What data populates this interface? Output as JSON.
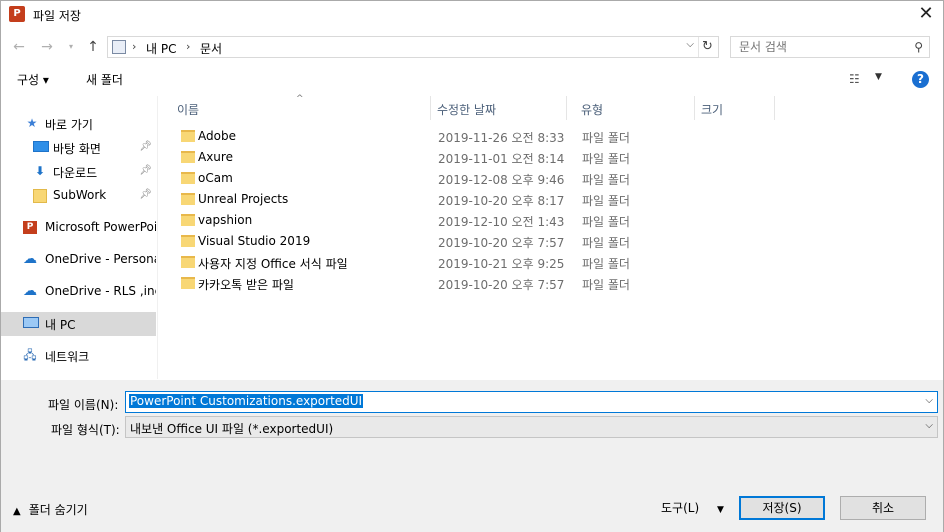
{
  "window": {
    "title": "파일 저장",
    "app_icon_glyph": "P"
  },
  "address": {
    "crumbs": [
      "내 PC",
      "문서"
    ],
    "search_placeholder": "문서 검색"
  },
  "toolbar": {
    "organize": "구성 ▾",
    "new_folder": "새 폴더",
    "help": "?"
  },
  "nav": {
    "items": [
      {
        "label": "바로 가기",
        "icon": "star-icon"
      },
      {
        "label": "바탕 화면",
        "icon": "desktop-icon",
        "pinned": true
      },
      {
        "label": "다운로드",
        "icon": "download-icon",
        "pinned": true
      },
      {
        "label": "SubWork",
        "icon": "folder-icon",
        "pinned": true
      },
      {
        "label": "Microsoft PowerPoin",
        "icon": "powerpoint-icon"
      },
      {
        "label": "OneDrive - Personal",
        "icon": "onedrive-icon"
      },
      {
        "label": "OneDrive - RLS ,inc",
        "icon": "onedrive-icon"
      },
      {
        "label": "내 PC",
        "icon": "pc-icon"
      },
      {
        "label": "네트워크",
        "icon": "network-icon"
      }
    ]
  },
  "columns": {
    "name": "이름",
    "date": "수정한 날짜",
    "type": "유형",
    "size": "크기"
  },
  "files": [
    {
      "name": "Adobe",
      "date": "2019-11-26 오전 8:33",
      "type": "파일 폴더"
    },
    {
      "name": "Axure",
      "date": "2019-11-01 오전 8:14",
      "type": "파일 폴더"
    },
    {
      "name": "oCam",
      "date": "2019-12-08 오후 9:46",
      "type": "파일 폴더"
    },
    {
      "name": "Unreal Projects",
      "date": "2019-10-20 오후 8:17",
      "type": "파일 폴더"
    },
    {
      "name": "vapshion",
      "date": "2019-12-10 오전 1:43",
      "type": "파일 폴더"
    },
    {
      "name": "Visual Studio 2019",
      "date": "2019-10-20 오후 7:57",
      "type": "파일 폴더"
    },
    {
      "name": "사용자 지정 Office 서식 파일",
      "date": "2019-10-21 오후 9:25",
      "type": "파일 폴더"
    },
    {
      "name": "카카오톡 받은 파일",
      "date": "2019-10-20 오후 7:57",
      "type": "파일 폴더"
    }
  ],
  "form": {
    "filename_label": "파일 이름(N):",
    "filename_value": "PowerPoint Customizations.exportedUI",
    "filetype_label": "파일 형식(T):",
    "filetype_value": "내보낸 Office UI 파일 (*.exportedUI)"
  },
  "footer": {
    "hide_folders": "폴더 숨기기",
    "tools": "도구(L)",
    "save": "저장(S)",
    "cancel": "취소"
  },
  "colors": {
    "accent": "#0078d7",
    "selected_nav": "#d9d9d9",
    "folder": "#f8d775"
  }
}
